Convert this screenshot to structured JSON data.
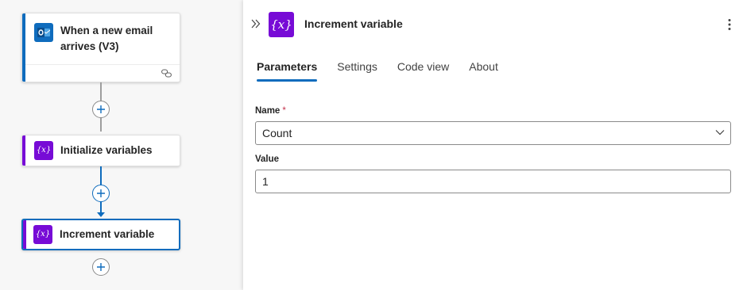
{
  "canvas": {
    "nodes": [
      {
        "title": "When a new email arrives (V3)",
        "icon": "outlook-icon"
      },
      {
        "title": "Initialize variables",
        "icon": "variable-icon"
      },
      {
        "title": "Increment variable",
        "icon": "variable-icon"
      }
    ]
  },
  "panel": {
    "title": "Increment variable",
    "icon": "variable-icon",
    "tabs": [
      {
        "label": "Parameters",
        "active": true
      },
      {
        "label": "Settings",
        "active": false
      },
      {
        "label": "Code view",
        "active": false
      },
      {
        "label": "About",
        "active": false
      }
    ],
    "fields": {
      "name": {
        "label": "Name",
        "required_mark": "*",
        "value": "Count"
      },
      "value": {
        "label": "Value",
        "value": "1"
      }
    }
  },
  "colors": {
    "accent": "#0f6cbd",
    "variable": "#770bd6",
    "required": "#c4314b"
  }
}
